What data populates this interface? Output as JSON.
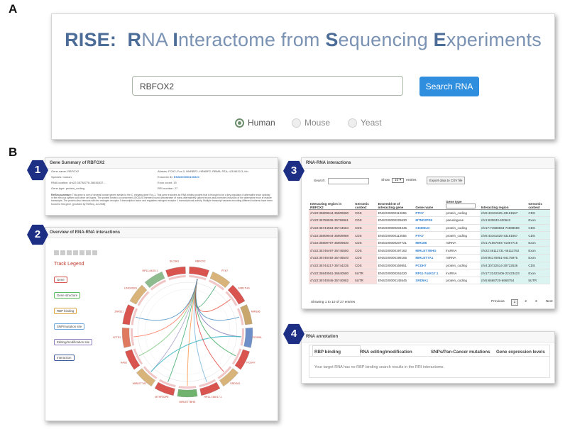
{
  "panel_labels": {
    "a": "A",
    "b": "B"
  },
  "badges": [
    "1",
    "2",
    "3",
    "4"
  ],
  "hero": {
    "title_parts": [
      {
        "t": "RISE:",
        "bold": true
      },
      {
        "t": "  ",
        "bold": false
      },
      {
        "t": "R",
        "bold": true
      },
      {
        "t": "NA ",
        "bold": false
      },
      {
        "t": "I",
        "bold": true
      },
      {
        "t": "nteractome from ",
        "bold": false
      },
      {
        "t": "S",
        "bold": true
      },
      {
        "t": "equencing ",
        "bold": false
      },
      {
        "t": "E",
        "bold": true
      },
      {
        "t": "xperiments",
        "bold": false
      }
    ],
    "search_value": "RBFOX2",
    "search_button": "Search RNA",
    "species": [
      {
        "label": "Human",
        "selected": true
      },
      {
        "label": "Mouse",
        "selected": false
      },
      {
        "label": "Yeast",
        "selected": false
      }
    ]
  },
  "gene_summary": {
    "title": "Gene Summary of RBFOX2",
    "fields_left": [
      {
        "k": "Gene name:",
        "v": "RBFOX2"
      },
      {
        "k": "Species:",
        "v": "human"
      },
      {
        "k": "RNA location:",
        "v": "chr22:35738776-36036337..."
      },
      {
        "k": "Gene type:",
        "v": "protein_coding"
      }
    ],
    "fields_right": [
      {
        "k": "Aliases:",
        "v": "FOX2; Fox-2; HNRBP2; HRNBP2; RBM9; RTA; dJ106I20.3; fxh"
      },
      {
        "k": "Ensembl ID:",
        "v": "ENSG00000100320"
      },
      {
        "k": "Exon count:",
        "v": "15"
      },
      {
        "k": "RRI number:",
        "v": "27"
      }
    ],
    "refseq_label": "RefSeq summary:",
    "refseq_text": "This gene is one of several human genes similar to the C. elegans gene Fox-1. This gene encodes an RNA binding protein that is thought to be a key regulator of alternative exon splicing in the nervous system and other cell types. The protein binds to a conserved UGCAUG element found downstream of many alternatively spliced exons and promotes inclusion of the alternative exon in mature transcripts. The protein also interacts with the estrogen receptor 1 transcription factor and regulates estrogen receptor 1 transcriptional activity. Multiple transcript variants encoding different isoforms have been found for this gene. [provided by RefSeq, Jul 2008]"
  },
  "overview": {
    "title": "Overview of RNA-RNA interactions",
    "legend_title": "Track Legend",
    "legend_items": [
      {
        "label": "Gene",
        "color": "#d9534f"
      },
      {
        "label": "Gene structure",
        "color": "#5cb85c"
      },
      {
        "label": "RBP binding",
        "color": "#d9a441"
      },
      {
        "label": "SNP/mutation site",
        "color": "#6fa8dc"
      },
      {
        "label": "Editing/modification site",
        "color": "#8e7cc3"
      },
      {
        "label": "Interaction",
        "color": "#3d5a99"
      }
    ],
    "circos_labels": [
      "RBFOX2",
      "PTK7",
      "MIR17HG",
      "MIR186",
      "CD300LD",
      "PCDH7",
      "SRDSA1",
      "RP11-744K17.1",
      "MIRLET7BHG",
      "MTHFD2P8",
      "MIRLET7A1",
      "HAS2",
      "KCTD1",
      "ZNF521",
      "LINC00301",
      "RP11-44O5.1",
      "SLC8A1"
    ]
  },
  "rri": {
    "title": "RNA-RNA interactions",
    "search_label": "Search:",
    "show_label": "Show",
    "show_value": "10",
    "entries_label": "entries",
    "export_button": "Export data to CSV file",
    "gene_type_placeholder": "",
    "columns": [
      "Interacting region in RBFOX2",
      "Genomic context",
      "Ensembl ID of interacting gene",
      "Gene name",
      "Gene type",
      "Interacting region",
      "Genomic context"
    ],
    "rows": [
      [
        "chr22:35809944-35809990",
        "CDS",
        "ENSG00000112655",
        "PTK7",
        "protein_coding",
        "chr6:43161525-43161567",
        "CDS"
      ],
      [
        "chr22:35759936-35759961",
        "CDS",
        "ENSG00000225630",
        "MTND2P28",
        "pseudogene",
        "chr1:630633-630642",
        "Exon"
      ],
      [
        "chr22:35744564-35744584",
        "CDS",
        "ENSG00000204345",
        "CD300LD",
        "protein_coding",
        "chr17:74588663-74588689",
        "CDS"
      ],
      [
        "chr22:35809944-35809988",
        "CDS",
        "ENSG00000112655",
        "PTK7",
        "protein_coding",
        "chr6:43161525-43161567",
        "CDS"
      ],
      [
        "chr22:35809797-35809830",
        "CDS",
        "ENSG00000207721",
        "MIR186",
        "miRNA",
        "chr1:71067694-71067716",
        "Exon"
      ],
      [
        "chr22:35746497-35746550",
        "CDS",
        "ENSG00000197182",
        "MIRLET7BHG",
        "lncRNA",
        "chr22:46112731-46112753",
        "Exon"
      ],
      [
        "chr22:35746492-35746540",
        "CDS",
        "ENSG00000199165",
        "MIRLET7A1",
        "miRNA",
        "chr9:94175951-94175975",
        "Exon"
      ],
      [
        "chr22:35744217-35744235",
        "CDS",
        "ENSG00000169851",
        "PCDH7",
        "protein_coding",
        "chr4:30722514-30722536",
        "CDS"
      ],
      [
        "chr22:35840561-35840580",
        "5UTR",
        "ENSG00000261020",
        "RP11-744K17.1",
        "lncRNA",
        "chr17:22423406-22423423",
        "Exon"
      ],
      [
        "chr22:35740046-35740082",
        "5UTR",
        "ENSG00000145545",
        "SRD5A1",
        "protein_coding",
        "chr5:6668720-6668754",
        "5UTR"
      ]
    ],
    "showing": "Showing 1 to 10 of 27 entries",
    "pagination": [
      "Previous",
      "1",
      "2",
      "3",
      "Next"
    ]
  },
  "annotation": {
    "title": "RNA annotation",
    "tabs": [
      "RBP binding",
      "RNA editing/modification",
      "SNPs/Pan-Cancer mutations",
      "Gene expression levels"
    ],
    "message": "Your target RNA has no RBP binding search results in the RRI interactome."
  }
}
